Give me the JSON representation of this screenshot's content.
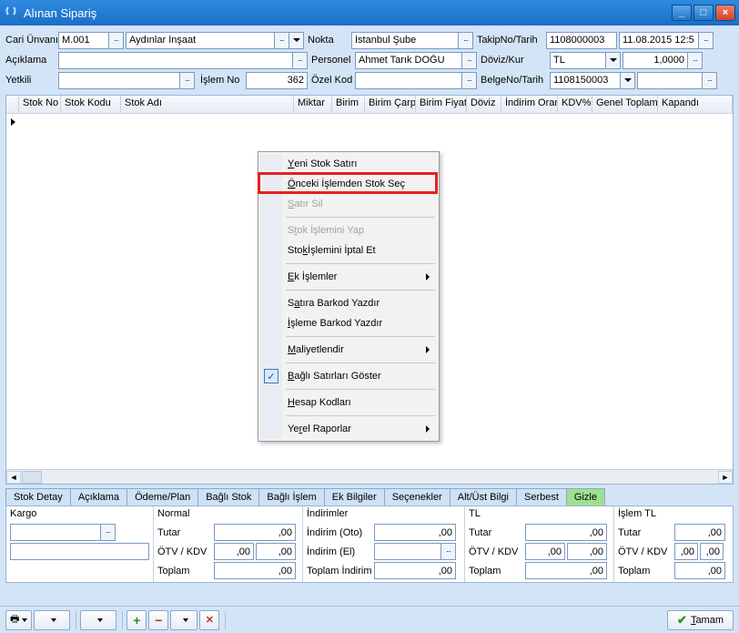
{
  "window": {
    "title": "Alınan Sipariş"
  },
  "form": {
    "cari_unvan_lbl": "Cari Ünvanı",
    "cari_code": "M.001",
    "cari_name": "Aydınlar İnşaat",
    "aciklama_lbl": "Açıklama",
    "aciklama": "",
    "yetkili_lbl": "Yetkili",
    "yetkili": "",
    "islem_no_lbl": "İşlem No",
    "islem_no": "362",
    "nokta_lbl": "Nokta",
    "nokta": "İstanbul Şube",
    "personel_lbl": "Personel",
    "personel": "Ahmet Tarık DOĞU",
    "ozel_kod_lbl": "Özel Kod",
    "ozel_kod": "",
    "takip_lbl": "TakipNo/Tarih",
    "takip_no": "1108000003",
    "takip_tarih": "11.08.2015 12:5",
    "doviz_lbl": "Döviz/Kur",
    "doviz": "TL",
    "kur": "1,0000",
    "belge_lbl": "BelgeNo/Tarih",
    "belge_no": "1108150003",
    "belge_tarih": ""
  },
  "grid_headers": [
    "Stok No",
    "Stok Kodu",
    "Stok Adı",
    "Miktar",
    "Birim",
    "Birim Çarp",
    "Birim Fiyat",
    "Döviz",
    "İndirim Oran",
    "KDV%",
    "Genel Toplam",
    "Kapandı"
  ],
  "context_menu": {
    "items": [
      {
        "label": "<u>Y</u>eni Stok Satırı"
      },
      {
        "label": "<u>Ö</u>nceki İşlemden Stok Seç",
        "highlight": true
      },
      {
        "label": "<u>S</u>atır Sil",
        "disabled": true
      },
      {
        "sep": true
      },
      {
        "label": "S<u>t</u>ok İşlemini Yap",
        "disabled": true
      },
      {
        "label": "Sto<u>k</u> İşlemini İptal Et"
      },
      {
        "sep": true
      },
      {
        "label": "<u>E</u>k İşlemler",
        "sub": true
      },
      {
        "sep": true
      },
      {
        "label": "S<u>a</u>tıra Barkod Yazdır"
      },
      {
        "label": "<u>İ</u>şleme Barkod Yazdır"
      },
      {
        "sep": true
      },
      {
        "label": "<u>M</u>aliyetlendir",
        "sub": true
      },
      {
        "sep": true
      },
      {
        "label": "<u>B</u>ağlı Satırları Göster",
        "checked": true
      },
      {
        "sep": true
      },
      {
        "label": "<u>H</u>esap Kodları"
      },
      {
        "sep": true
      },
      {
        "label": "Ye<u>r</u>el Raporlar",
        "sub": true
      }
    ]
  },
  "tabs": [
    "Stok Detay",
    "Açıklama",
    "Ödeme/Plan",
    "Bağlı Stok",
    "Bağlı İşlem",
    "Ek Bilgiler",
    "Seçenekler",
    "Alt/Üst Bilgi",
    "Serbest",
    "Gizle"
  ],
  "active_tab": 9,
  "summary": {
    "kargo_lbl": "Kargo",
    "normal_lbl": "Normal",
    "indirimler_lbl": "İndirimler",
    "tl_lbl": "TL",
    "islem_tl_lbl": "İşlem TL",
    "tutar_lbl": "Tutar",
    "otv_kdv_lbl": "ÖTV / KDV",
    "toplam_lbl": "Toplam",
    "indirim_oto_lbl": "İndirim (Oto)",
    "indirim_el_lbl": "İndirim (El)",
    "toplam_indirim_lbl": "Toplam İndirim",
    "zero": ",00"
  },
  "footer": {
    "tamam": "Tamam"
  }
}
